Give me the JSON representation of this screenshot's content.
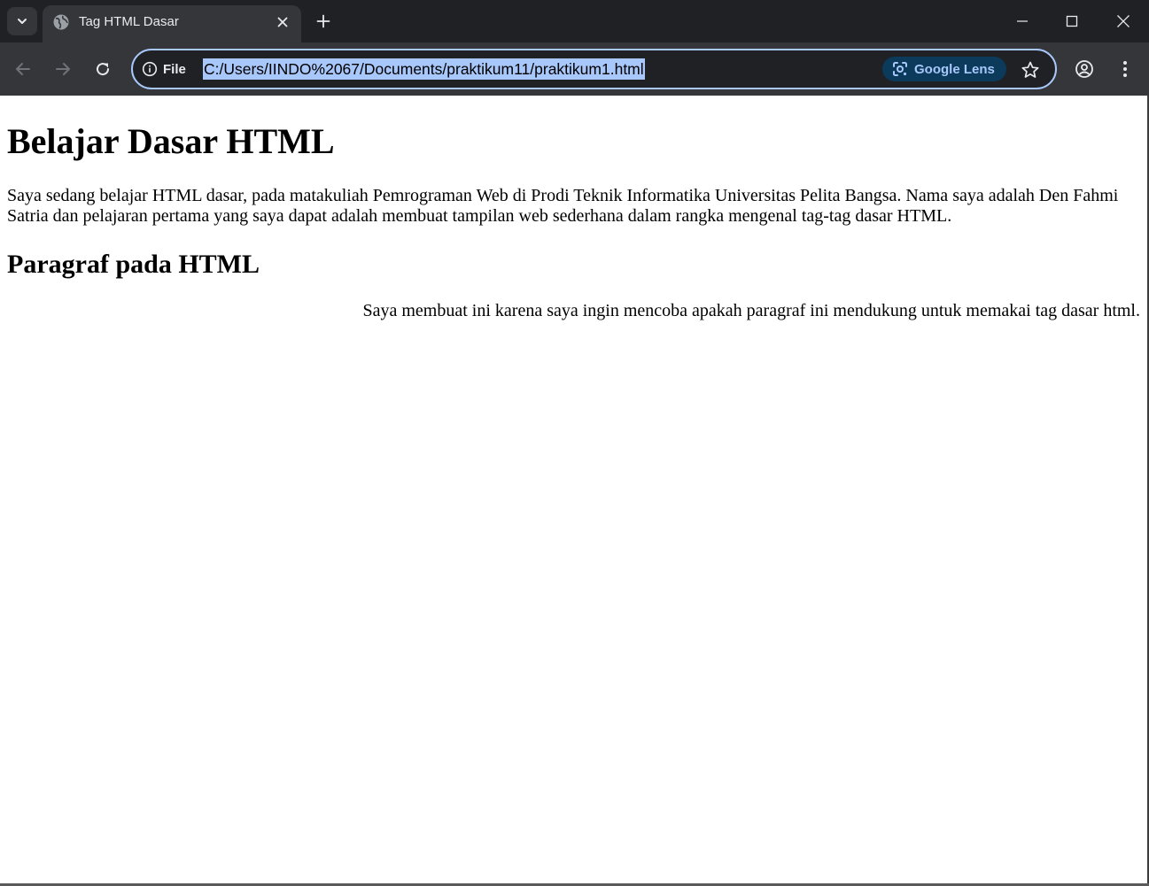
{
  "browser": {
    "tab": {
      "title": "Tag HTML Dasar",
      "favicon": "globe-icon"
    },
    "window_controls": [
      "minimize-icon",
      "maximize-icon",
      "close-icon"
    ],
    "toolbar": {
      "site_info_label": "File",
      "url": "C:/Users/IINDO%2067/Documents/praktikum11/praktikum1.html",
      "lens_label": "Google Lens"
    },
    "colors": {
      "tabstrip_bg": "#202124",
      "toolbar_bg": "#35363a",
      "omnibox_border": "#a8c7fa",
      "url_selection": "#a8c7fa",
      "lens_chip_bg": "#0b3a5b"
    }
  },
  "page": {
    "heading1": "Belajar Dasar HTML",
    "paragraph1": "Saya sedang belajar HTML dasar, pada matakuliah Pemrograman Web di Prodi Teknik Informatika Universitas Pelita Bangsa. Nama saya adalah Den Fahmi Satria dan pelajaran pertama yang saya dapat adalah membuat tampilan web sederhana dalam rangka mengenal tag-tag dasar HTML.",
    "heading2": "Paragraf pada HTML",
    "paragraph2": "Saya membuat ini karena saya ingin mencoba apakah paragraf ini mendukung untuk memakai tag dasar html."
  }
}
